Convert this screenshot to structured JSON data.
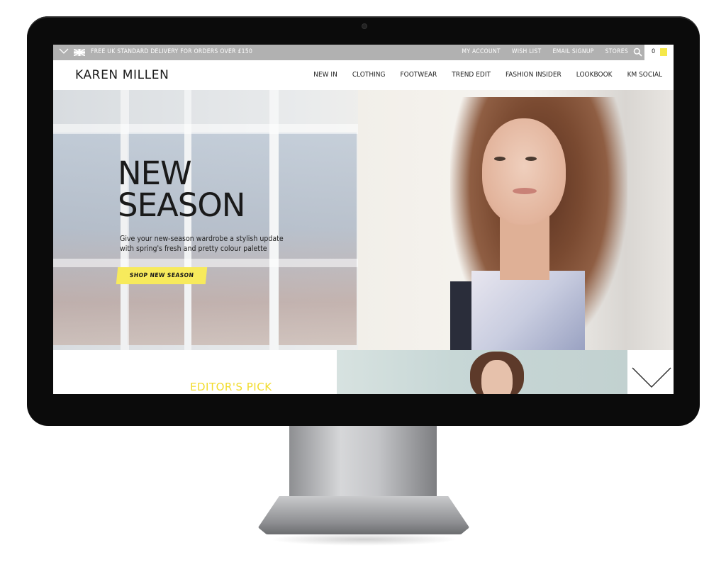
{
  "topbar": {
    "promo": "FREE UK STANDARD DELIVERY FOR ORDERS OVER £150",
    "links": [
      "MY ACCOUNT",
      "WISH LIST",
      "EMAIL SIGNUP",
      "STORES"
    ],
    "basket_count": "0",
    "icons": [
      "chevron-down-icon",
      "uk-flag-icon",
      "search-icon",
      "shopping-bag-icon"
    ]
  },
  "header": {
    "logo": "KAREN MILLEN",
    "nav": [
      "NEW IN",
      "CLOTHING",
      "FOOTWEAR",
      "TREND EDIT",
      "FASHION INSIDER",
      "LOOKBOOK",
      "KM SOCIAL"
    ]
  },
  "hero": {
    "title_line1": "NEW",
    "title_line2": "SEASON",
    "subtitle_line1": "Give your new-season wardrobe a stylish update",
    "subtitle_line2": "with spring's fresh and pretty colour palette",
    "cta": "SHOP NEW SEASON"
  },
  "strip": {
    "heading": "EDITOR'S PICK",
    "scroll_icon": "chevron-down-icon"
  },
  "colors": {
    "accent_yellow": "#f7ea5c",
    "heading_yellow": "#f2dc2c",
    "topbar_grey": "#b1b1b1"
  }
}
